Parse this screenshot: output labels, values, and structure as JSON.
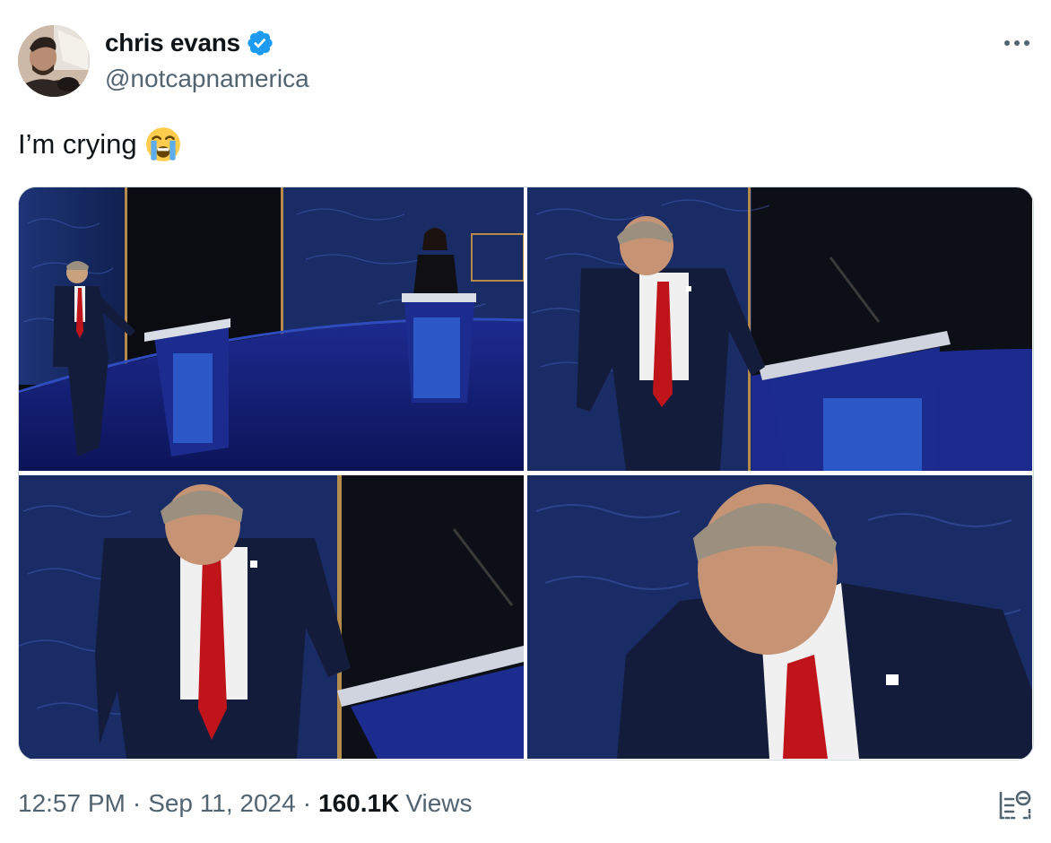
{
  "tweet": {
    "author": {
      "display_name": "chris evans",
      "handle": "@notcapnamerica",
      "verified": true
    },
    "text": "I’m crying",
    "emoji": "loudly-crying-face",
    "media": [
      {
        "description": "debate-stage-wide-shot"
      },
      {
        "description": "man-at-podium-medium-shot"
      },
      {
        "description": "man-at-podium-closer"
      },
      {
        "description": "man-face-closeup"
      }
    ],
    "time": "12:57 PM",
    "date": "Sep 11, 2024",
    "separator": "·",
    "views_count": "160.1K",
    "views_label": "Views"
  },
  "colors": {
    "verified": "#1d9bf0",
    "secondary_text": "#536471",
    "primary_text": "#0f1419",
    "stage_blue": "#1b2a8a"
  }
}
